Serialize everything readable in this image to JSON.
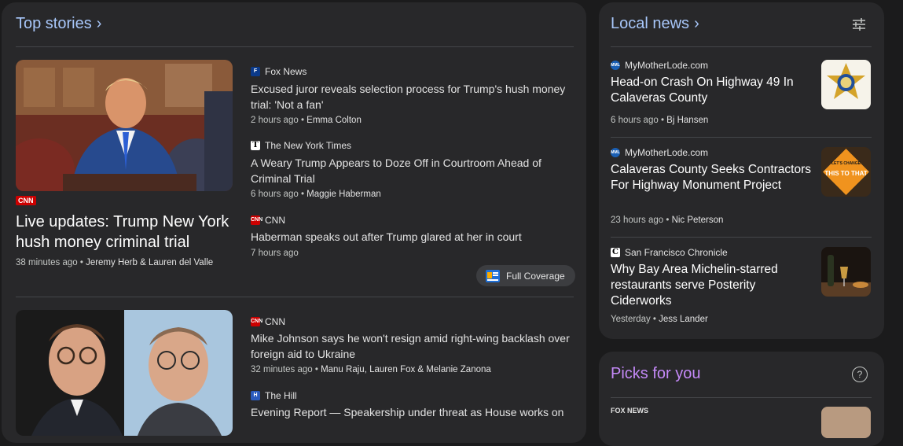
{
  "top_stories": {
    "title": "Top stories",
    "lead1": {
      "source_badge": "CNN",
      "headline": "Live updates: Trump New York hush money criminal trial",
      "time": "38 minutes ago",
      "author": "Jeremy Herb & Lauren del Valle"
    },
    "related1": [
      {
        "source": "Fox News",
        "logo": "fox",
        "headline": "Excused juror reveals selection process for Trump's hush money trial: 'Not a fan'",
        "time": "2 hours ago",
        "author": "Emma Colton"
      },
      {
        "source": "The New York Times",
        "logo": "nyt",
        "headline": "A Weary Trump Appears to Doze Off in Courtroom Ahead of Criminal Trial",
        "time": "6 hours ago",
        "author": "Maggie Haberman"
      },
      {
        "source": "CNN",
        "logo": "cnn",
        "headline": "Haberman speaks out after Trump glared at her in court",
        "time": "7 hours ago",
        "author": ""
      }
    ],
    "full_coverage_label": "Full Coverage",
    "related2": [
      {
        "source": "CNN",
        "logo": "cnn",
        "headline": "Mike Johnson says he won't resign amid right-wing backlash over foreign aid to Ukraine",
        "time": "32 minutes ago",
        "author": "Manu Raju, Lauren Fox & Melanie Zanona"
      },
      {
        "source": "The Hill",
        "logo": "hill",
        "headline": "Evening Report — Speakership under threat as House works on"
      }
    ]
  },
  "local_news": {
    "title": "Local news",
    "items": [
      {
        "source": "MyMotherLode.com",
        "headline": "Head-on Crash On Highway 49 In Calaveras County",
        "time": "6 hours ago",
        "author": "Bj Hansen"
      },
      {
        "source": "MyMotherLode.com",
        "headline": "Calaveras County Seeks Contractors For Highway Monument Project",
        "time": "23 hours ago",
        "author": "Nic Peterson"
      },
      {
        "source": "San Francisco Chronicle",
        "headline": "Why Bay Area Michelin-starred restaurants serve Posterity Ciderworks",
        "time": "Yesterday",
        "author": "Jess Lander"
      }
    ]
  },
  "picks": {
    "title": "Picks for you",
    "help_glyph": "?",
    "first_source": "FOX NEWS"
  },
  "thumb_text": {
    "lets_change": "LET'S CHANGE",
    "this_that": "THIS TO THAT"
  },
  "colors": {
    "accent": "#a8c7fa",
    "picks_accent": "#c58af9",
    "background": "#1b1b1c",
    "panel": "#28282a"
  }
}
